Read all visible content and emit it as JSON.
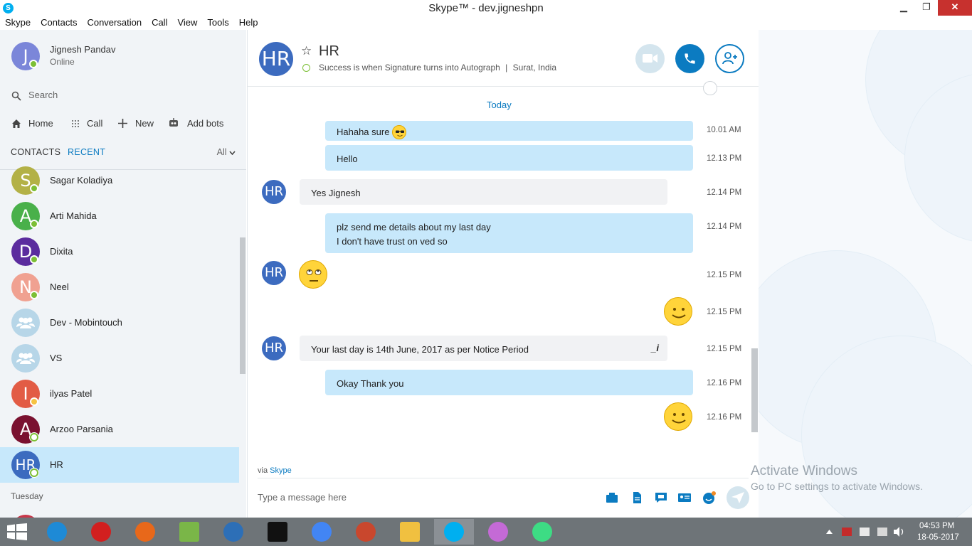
{
  "window": {
    "title": "Skype™ - dev.jigneshpn",
    "app_icon_letter": "S",
    "minimize": "▁",
    "restore": "❐",
    "close": "✕"
  },
  "menu": [
    "Skype",
    "Contacts",
    "Conversation",
    "Call",
    "View",
    "Tools",
    "Help"
  ],
  "profile": {
    "initial": "J",
    "name": "Jignesh Pandav",
    "status": "Online"
  },
  "search": {
    "label": "Search"
  },
  "nav": {
    "home": "Home",
    "call": "Call",
    "new": "New",
    "add_bots": "Add bots"
  },
  "tabs": {
    "contacts": "CONTACTS",
    "recent": "RECENT",
    "filter": "All"
  },
  "contacts": [
    {
      "initial": "S",
      "name": "Sagar Koladiya",
      "color": "#b3b146",
      "status": "online"
    },
    {
      "initial": "A",
      "name": "Arti Mahida",
      "color": "#49b04a",
      "status": "online"
    },
    {
      "initial": "D",
      "name": "Dixita",
      "color": "#5b2c9e",
      "status": "online"
    },
    {
      "initial": "N",
      "name": "Neel",
      "color": "#f0a191",
      "status": "online"
    },
    {
      "initial": "",
      "name": "Dev - Mobintouch",
      "color": "#b7d6e8",
      "status": "group"
    },
    {
      "initial": "",
      "name": "VS",
      "color": "#b7d6e8",
      "status": "group"
    },
    {
      "initial": "I",
      "name": "ilyas Patel",
      "color": "#e25c45",
      "status": "away"
    },
    {
      "initial": "A",
      "name": "Arzoo Parsania",
      "color": "#7a1130",
      "status": "offline"
    },
    {
      "initial": "HR",
      "name": "HR",
      "color": "#3c6bbf",
      "status": "offline",
      "active": true
    }
  ],
  "section_label": "Tuesday",
  "chat": {
    "initials": "HR",
    "name": "HR",
    "mood": "Success is when Signature turns into Autograph",
    "location_sep": "|",
    "location": "Surat, India",
    "day_label": "Today",
    "via_prefix": "via",
    "via_link": "Skype",
    "compose_placeholder": "Type a message here",
    "edited_mark": "_i"
  },
  "messages": [
    {
      "dir": "out",
      "lines": [
        "Hahaha sure"
      ],
      "time": "10.01 AM",
      "emoji": "cool"
    },
    {
      "dir": "out",
      "lines": [
        "Hello"
      ],
      "time": "12.13 PM"
    },
    {
      "dir": "in",
      "lines": [
        "Yes Jignesh"
      ],
      "time": "12.14 PM"
    },
    {
      "dir": "out",
      "lines": [
        "plz send me details about my last day",
        "I don't have trust on ved so"
      ],
      "time": "12.14 PM"
    },
    {
      "dir": "in",
      "lines": [],
      "time": "12.15 PM",
      "emoji": "rolling-eyes"
    },
    {
      "dir": "out",
      "lines": [],
      "time": "12.15 PM",
      "emoji": "smile"
    },
    {
      "dir": "in",
      "lines": [
        "Your last day is 14th June, 2017 as per Notice Period"
      ],
      "time": "12.15 PM"
    },
    {
      "dir": "out",
      "lines": [
        "Okay Thank you"
      ],
      "time": "12.16 PM"
    },
    {
      "dir": "out",
      "lines": [],
      "time": "12.16 PM",
      "emoji": "smile"
    }
  ],
  "watermark": {
    "line1": "Activate Windows",
    "line2": "Go to PC settings to activate Windows."
  },
  "taskbar": {
    "time": "04:53 PM",
    "date": "18-05-2017",
    "apps": [
      "internet-explorer",
      "opera",
      "firefox",
      "notepad-plus-plus",
      "virtualbox",
      "command-prompt",
      "chrome",
      "filezilla",
      "file-explorer",
      "skype",
      "picasa",
      "android-studio"
    ]
  },
  "colors": {
    "accent": "#0b7bc1",
    "online": "#7cbf35",
    "away": "#f6c342",
    "bubble_out": "#c7e8fb",
    "bubble_in": "#f1f2f4"
  }
}
